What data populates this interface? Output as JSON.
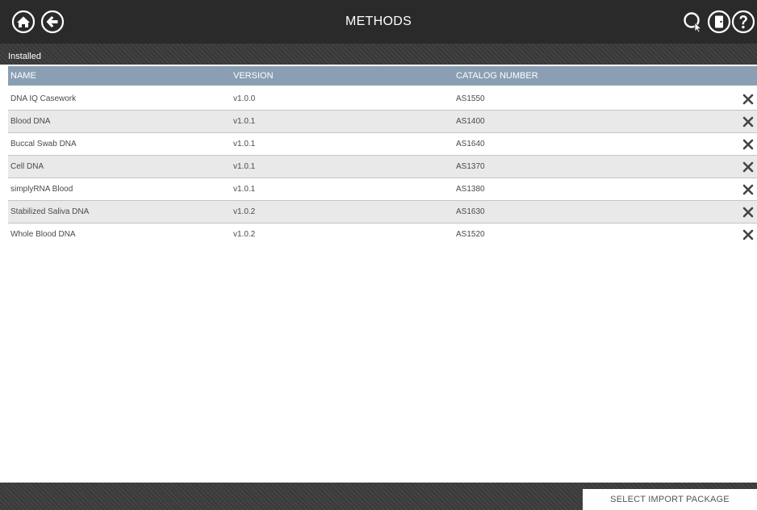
{
  "header": {
    "title": "METHODS",
    "icons": {
      "home": "home-icon",
      "back": "back-arrow-icon",
      "search": "search-icon",
      "logout": "logout-icon",
      "help": "help-icon"
    }
  },
  "section": {
    "label": "Installed"
  },
  "table": {
    "columns": [
      "NAME",
      "VERSION",
      "CATALOG NUMBER"
    ],
    "rows": [
      {
        "name": "DNA IQ Casework",
        "version": "v1.0.0",
        "catalog": "AS1550"
      },
      {
        "name": "Blood DNA",
        "version": "v1.0.1",
        "catalog": "AS1400"
      },
      {
        "name": "Buccal Swab DNA",
        "version": "v1.0.1",
        "catalog": "AS1640"
      },
      {
        "name": "Cell DNA",
        "version": "v1.0.1",
        "catalog": "AS1370"
      },
      {
        "name": "simplyRNA Blood",
        "version": "v1.0.1",
        "catalog": "AS1380"
      },
      {
        "name": "Stabilized Saliva DNA",
        "version": "v1.0.2",
        "catalog": "AS1630"
      },
      {
        "name": "Whole Blood DNA",
        "version": "v1.0.2",
        "catalog": "AS1520"
      }
    ],
    "row_action_icon": "close-icon"
  },
  "footer": {
    "import_button": "SELECT IMPORT PACKAGE"
  },
  "colors": {
    "header_bg": "#2a2a2a",
    "table_header_bg": "#8a9fb3",
    "row_alt_bg": "#e9e9e9"
  }
}
